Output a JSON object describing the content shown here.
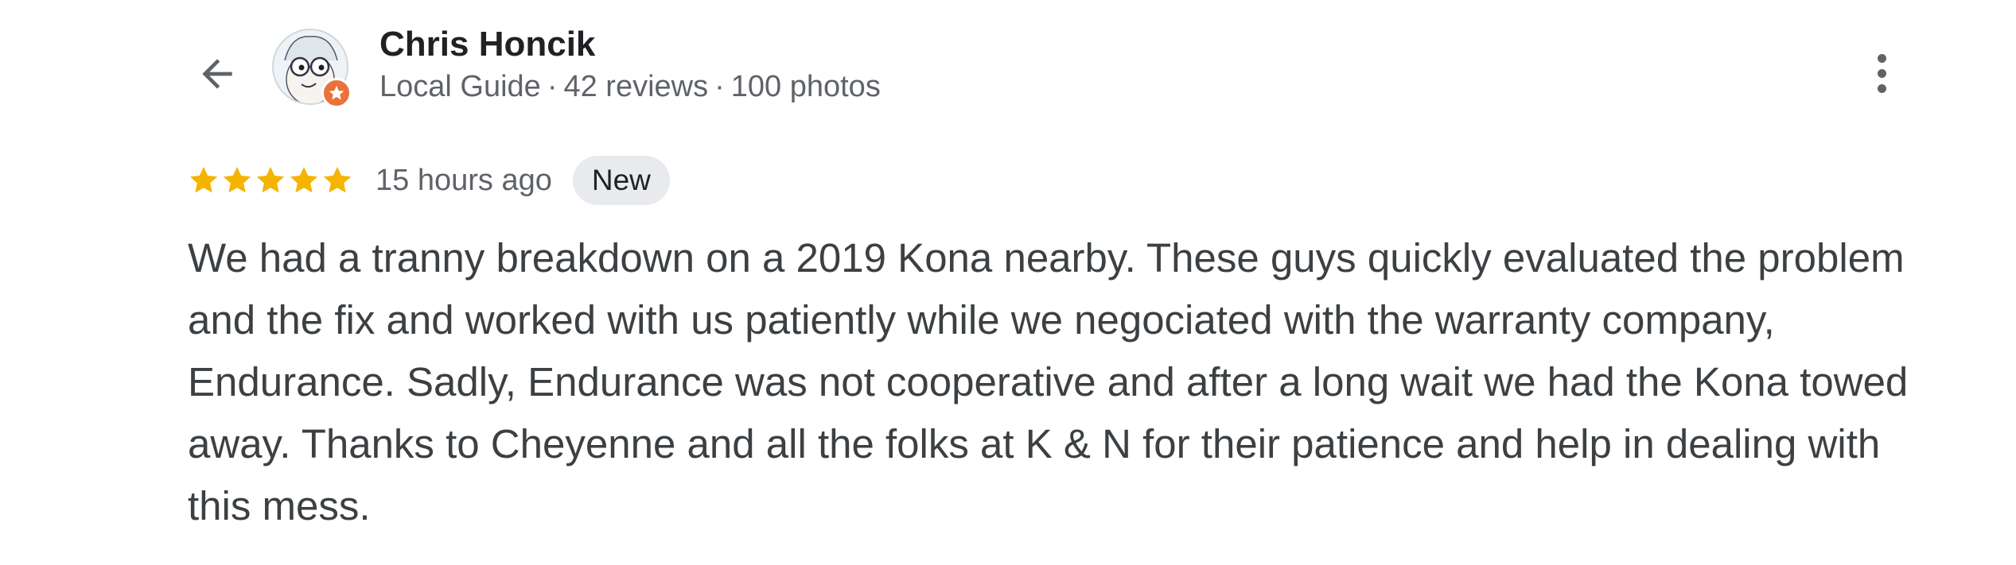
{
  "reviewer": {
    "name": "Chris Honcik",
    "level": "Local Guide",
    "reviews": "42 reviews",
    "photos": "100 photos",
    "separator": "·"
  },
  "review": {
    "rating": 5,
    "max_rating": 5,
    "time": "15 hours ago",
    "badge": "New",
    "text": "We had a tranny breakdown on a 2019 Kona nearby. These guys quickly evaluated the problem and the fix and worked with us patiently while we negociated with the warranty company, Endurance. Sadly, Endurance was not cooperative and after a long wait we had the Kona towed away. Thanks to Cheyenne and all the folks at K & N for their patience and help in dealing with this mess."
  },
  "icons": {
    "back": "arrow-back-icon",
    "more": "more-vert-icon",
    "star": "star-icon",
    "badge": "local-guide-badge-icon"
  },
  "colors": {
    "star": "#F4B400",
    "guide_badge": "#E8733A",
    "meta_text": "#5F6368",
    "badge_bg": "#E8EAED"
  }
}
